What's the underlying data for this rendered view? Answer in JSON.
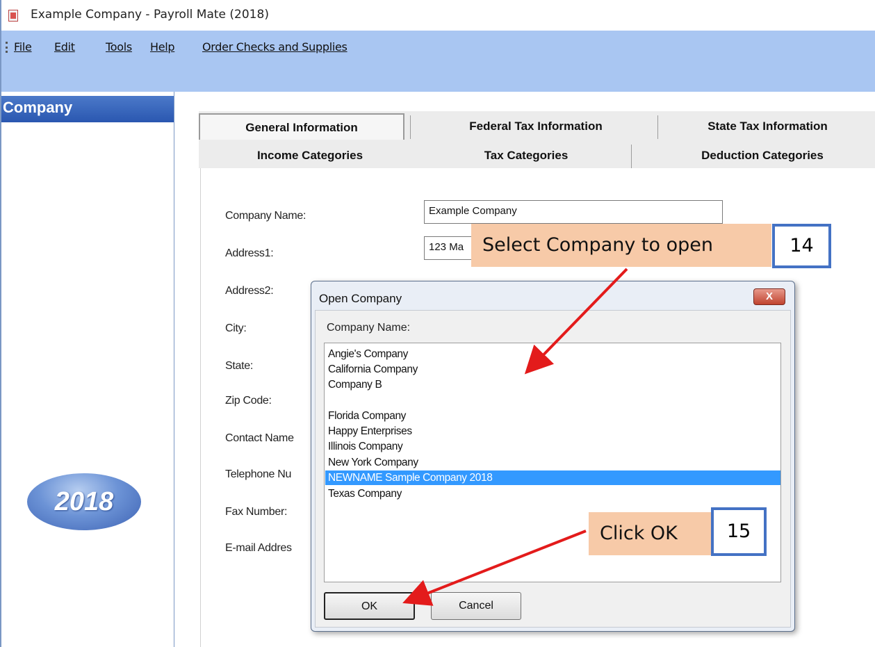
{
  "window": {
    "title": "Example Company - Payroll Mate (2018)"
  },
  "menu": {
    "file": "File",
    "edit": "Edit",
    "tools": "Tools",
    "help": "Help",
    "order": "Order Checks and Supplies"
  },
  "sidebar": {
    "title": "Company",
    "year_badge": "2018"
  },
  "tabs": {
    "row1": [
      "General Information",
      "Federal Tax Information",
      "State Tax Information"
    ],
    "row2": [
      "Income Categories",
      "Tax Categories",
      "Deduction Categories"
    ],
    "active": "General Information"
  },
  "form": {
    "company_name_label": "Company Name:",
    "company_name_value": "Example Company",
    "address1_label": "Address1:",
    "address1_value": "123 Ma",
    "address2_label": "Address2:",
    "city_label": "City:",
    "state_label": "State:",
    "zip_label": "Zip Code:",
    "contact_label": "Contact Name",
    "telephone_label": "Telephone Nu",
    "fax_label": "Fax Number:",
    "email_label": "E-mail Addres"
  },
  "dialog": {
    "title": "Open Company",
    "close_label": "X",
    "list_label": "Company Name:",
    "companies": [
      "Angie's Company",
      "California Company",
      "Company B",
      "",
      "Florida Company",
      "Happy Enterprises",
      "Illinois Company",
      "New York Company",
      "NEWNAME Sample Company 2018",
      "Texas Company"
    ],
    "selected": "NEWNAME Sample Company 2018",
    "ok_label": "OK",
    "cancel_label": "Cancel"
  },
  "annotations": {
    "callout1": "Select Company to open",
    "step1": "14",
    "callout2": "Click OK",
    "step2": "15",
    "arrow_color": "#e31b1b",
    "callout_color": "#f7caa8",
    "step_border_color": "#4472c4"
  }
}
